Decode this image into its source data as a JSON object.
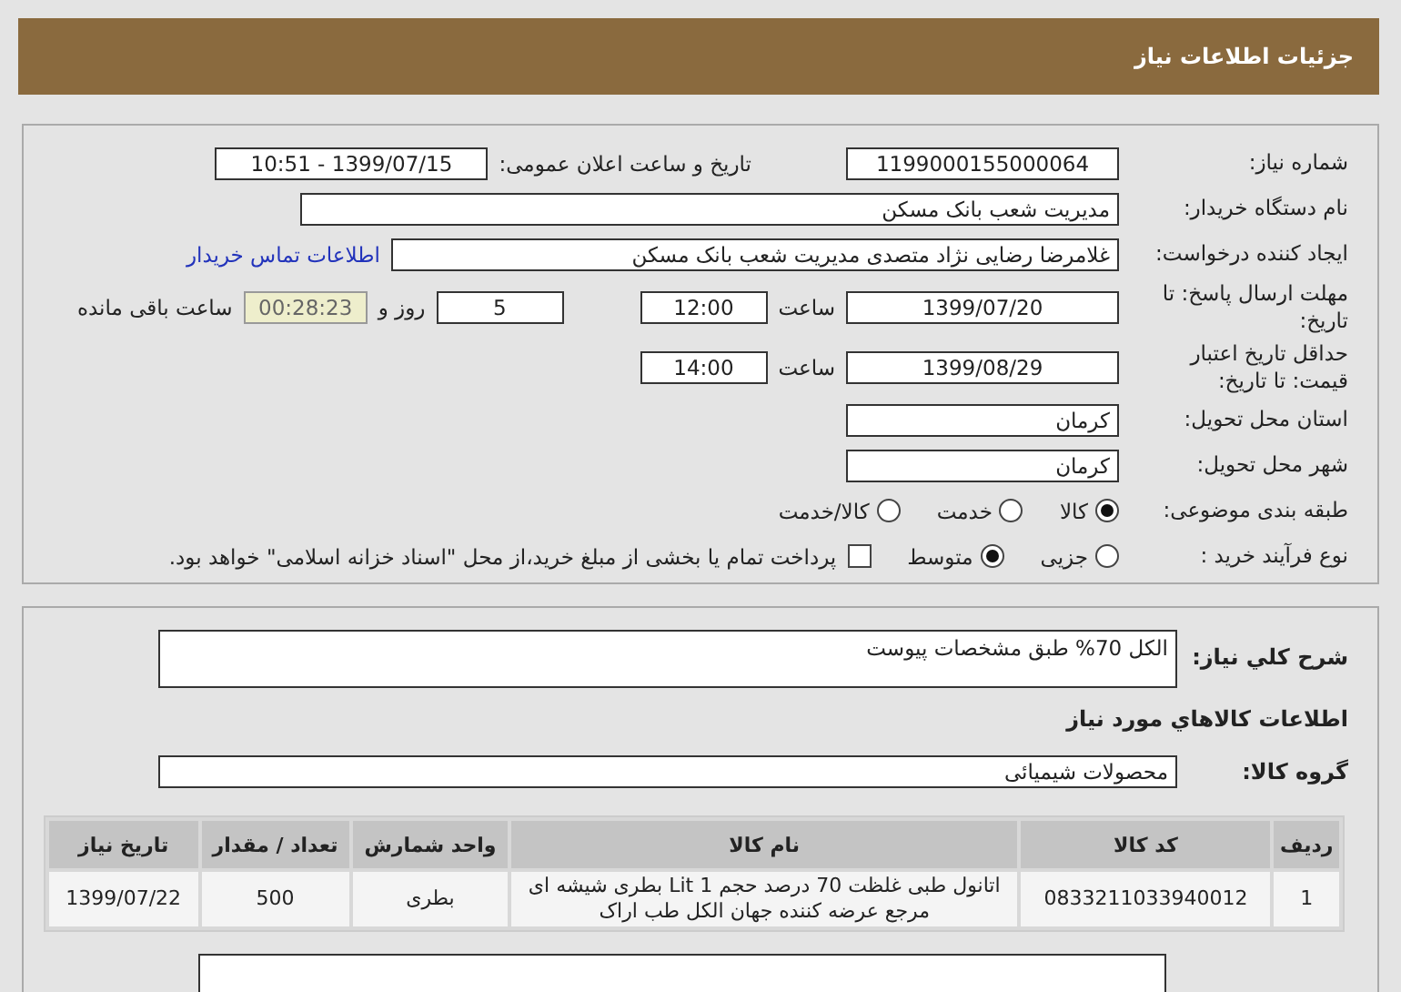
{
  "header": {
    "title": "جزئیات اطلاعات نیاز"
  },
  "details": {
    "need_number": {
      "label": "شماره نیاز:",
      "value": "1199000155000064"
    },
    "announce": {
      "label": "تاریخ و ساعت اعلان عمومی:",
      "value": "1399/07/15 - 10:51"
    },
    "buyer": {
      "label": "نام دستگاه خریدار:",
      "value": "مدیریت شعب بانک مسکن"
    },
    "creator": {
      "label": "ایجاد کننده درخواست:",
      "value": "غلامرضا رضایی نژاد متصدی  مدیریت شعب بانک مسکن",
      "link": "اطلاعات تماس خریدار"
    },
    "reply_deadline": {
      "label": "مهلت ارسال پاسخ: تا تاریخ:",
      "date": "1399/07/20",
      "time_label": "ساعت",
      "time": "12:00",
      "days": "5",
      "days_label": "روز و",
      "remaining": "00:28:23",
      "remaining_label": "ساعت باقی مانده"
    },
    "price_validity": {
      "label": "حداقل تاریخ اعتبار قیمت: تا تاریخ:",
      "date": "1399/08/29",
      "time_label": "ساعت",
      "time": "14:00"
    },
    "province": {
      "label": "استان محل تحویل:",
      "value": "کرمان"
    },
    "city": {
      "label": "شهر محل تحویل:",
      "value": "کرمان"
    },
    "category": {
      "label": "طبقه بندی موضوعی:",
      "options": [
        {
          "label": "کالا",
          "selected": true
        },
        {
          "label": "خدمت",
          "selected": false
        },
        {
          "label": "کالا/خدمت",
          "selected": false
        }
      ]
    },
    "process": {
      "label": "نوع فرآیند خرید :",
      "options": [
        {
          "label": "جزیی",
          "selected": false
        },
        {
          "label": "متوسط",
          "selected": true
        }
      ],
      "treasury": {
        "label": "پرداخت تمام یا بخشی از مبلغ خرید،از محل \"اسناد خزانه اسلامی\" خواهد بود.",
        "checked": false
      }
    }
  },
  "description": {
    "label": "شرح کلي نياز:",
    "value": "الکل  70% طبق مشخصات پیوست"
  },
  "goods": {
    "heading": "اطلاعات کالاهاي مورد نياز",
    "group_label": "گروه کالا:",
    "group": "محصولات شیمیائی",
    "table": {
      "columns": [
        "ردیف",
        "کد کالا",
        "نام کالا",
        "واحد شمارش",
        "تعداد / مقدار",
        "تاریخ نیاز"
      ],
      "rows": [
        [
          "1",
          "0833211033940012",
          "اتانول طبی غلظت 70 درصد حجم 1 Lit بطری شیشه ای مرجع عرضه کننده جهان الکل طب اراک",
          "بطری",
          "500",
          "1399/07/22"
        ]
      ]
    }
  }
}
